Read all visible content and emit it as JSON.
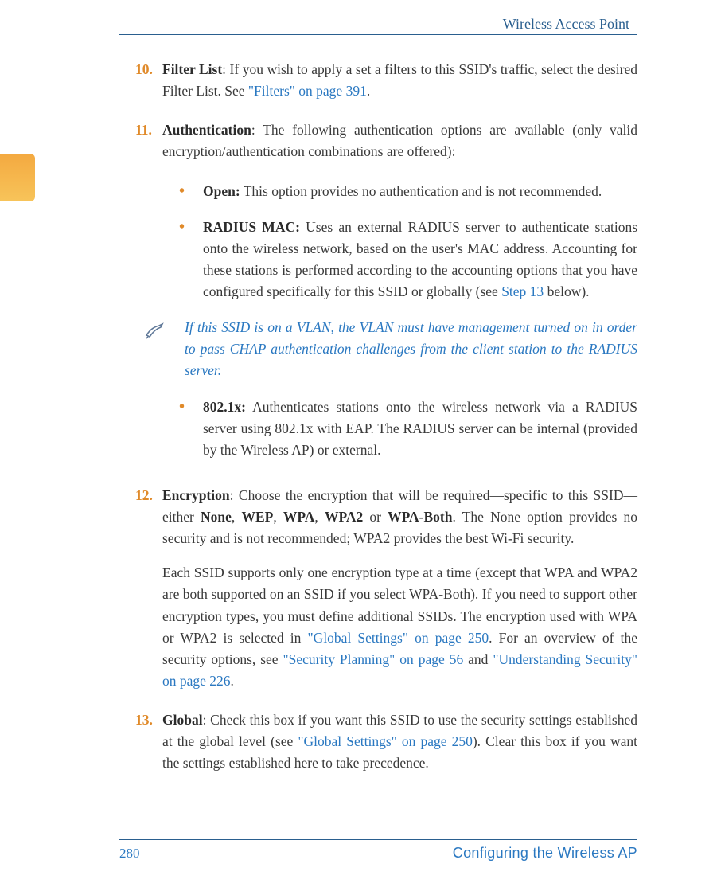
{
  "header": {
    "title": "Wireless Access Point"
  },
  "items": [
    {
      "num": "10.",
      "title": "Filter List",
      "sep": ": ",
      "text_a": "If you wish to apply a set a filters to this SSID's traffic, select the desired Filter List. See ",
      "link_a": "\"Filters\" on page 391",
      "text_b": "."
    },
    {
      "num": "11.",
      "title": "Authentication",
      "sep": ": ",
      "text_a": "The following authentication options are available (only valid encryption/authentication combinations are offered):"
    }
  ],
  "bullets_11": [
    {
      "title": "Open:",
      "text_a": " This option provides no authentication and is not recommended."
    },
    {
      "title": "RADIUS MAC:",
      "text_a": " Uses an external RADIUS server to authenticate stations onto the wireless network, based on the user's MAC address. Accounting for these stations is performed according to the accounting options that you have configured specifically for this SSID or globally (see ",
      "link_a": "Step 13",
      "text_b": " below)."
    }
  ],
  "note": {
    "text": "If this SSID is on a VLAN, the VLAN must have management turned on in order to pass CHAP authentication challenges from the client station to the RADIUS server."
  },
  "bullets_11b": [
    {
      "title": "802.1x:",
      "text_a": " Authenticates stations onto the wireless network via a RADIUS server using 802.1x with EAP. The RADIUS server can be internal (provided by the Wireless AP) or external."
    }
  ],
  "items2": [
    {
      "num": "12.",
      "title": "Encryption",
      "sep": ": ",
      "text_a": "Choose the encryption that will be required—specific to this SSID—either ",
      "b1": "None",
      "c1": ", ",
      "b2": "WEP",
      "c2": ", ",
      "b3": "WPA",
      "c3": ", ",
      "b4": "WPA2",
      "c4": " or ",
      "b5": "WPA-Both",
      "text_b": ". The None option provides no security and is not recommended; WPA2 provides the best Wi-Fi security.",
      "para2_a": "Each SSID supports only one encryption type at a time (except that WPA and WPA2 are both supported on an SSID if you select WPA-Both). If you need to support other encryption types, you must define additional SSIDs. The encryption used with WPA or WPA2 is selected in ",
      "link2_a": "\"Global Settings\" on page 250",
      "para2_b": ". For an overview of the security options, see ",
      "link2_b": "\"Security Planning\" on page 56",
      "para2_c": " and ",
      "link2_c": "\"Understanding Security\" on page 226",
      "para2_d": "."
    },
    {
      "num": "13.",
      "title": "Global",
      "sep": ": ",
      "text_a": "Check this box if you want this SSID to use the security settings established at the global level (see ",
      "link_a": "\"Global Settings\" on page 250",
      "text_b": "). Clear this box if you want the settings established here to take precedence."
    }
  ],
  "footer": {
    "page": "280",
    "label": "Configuring the Wireless AP"
  }
}
